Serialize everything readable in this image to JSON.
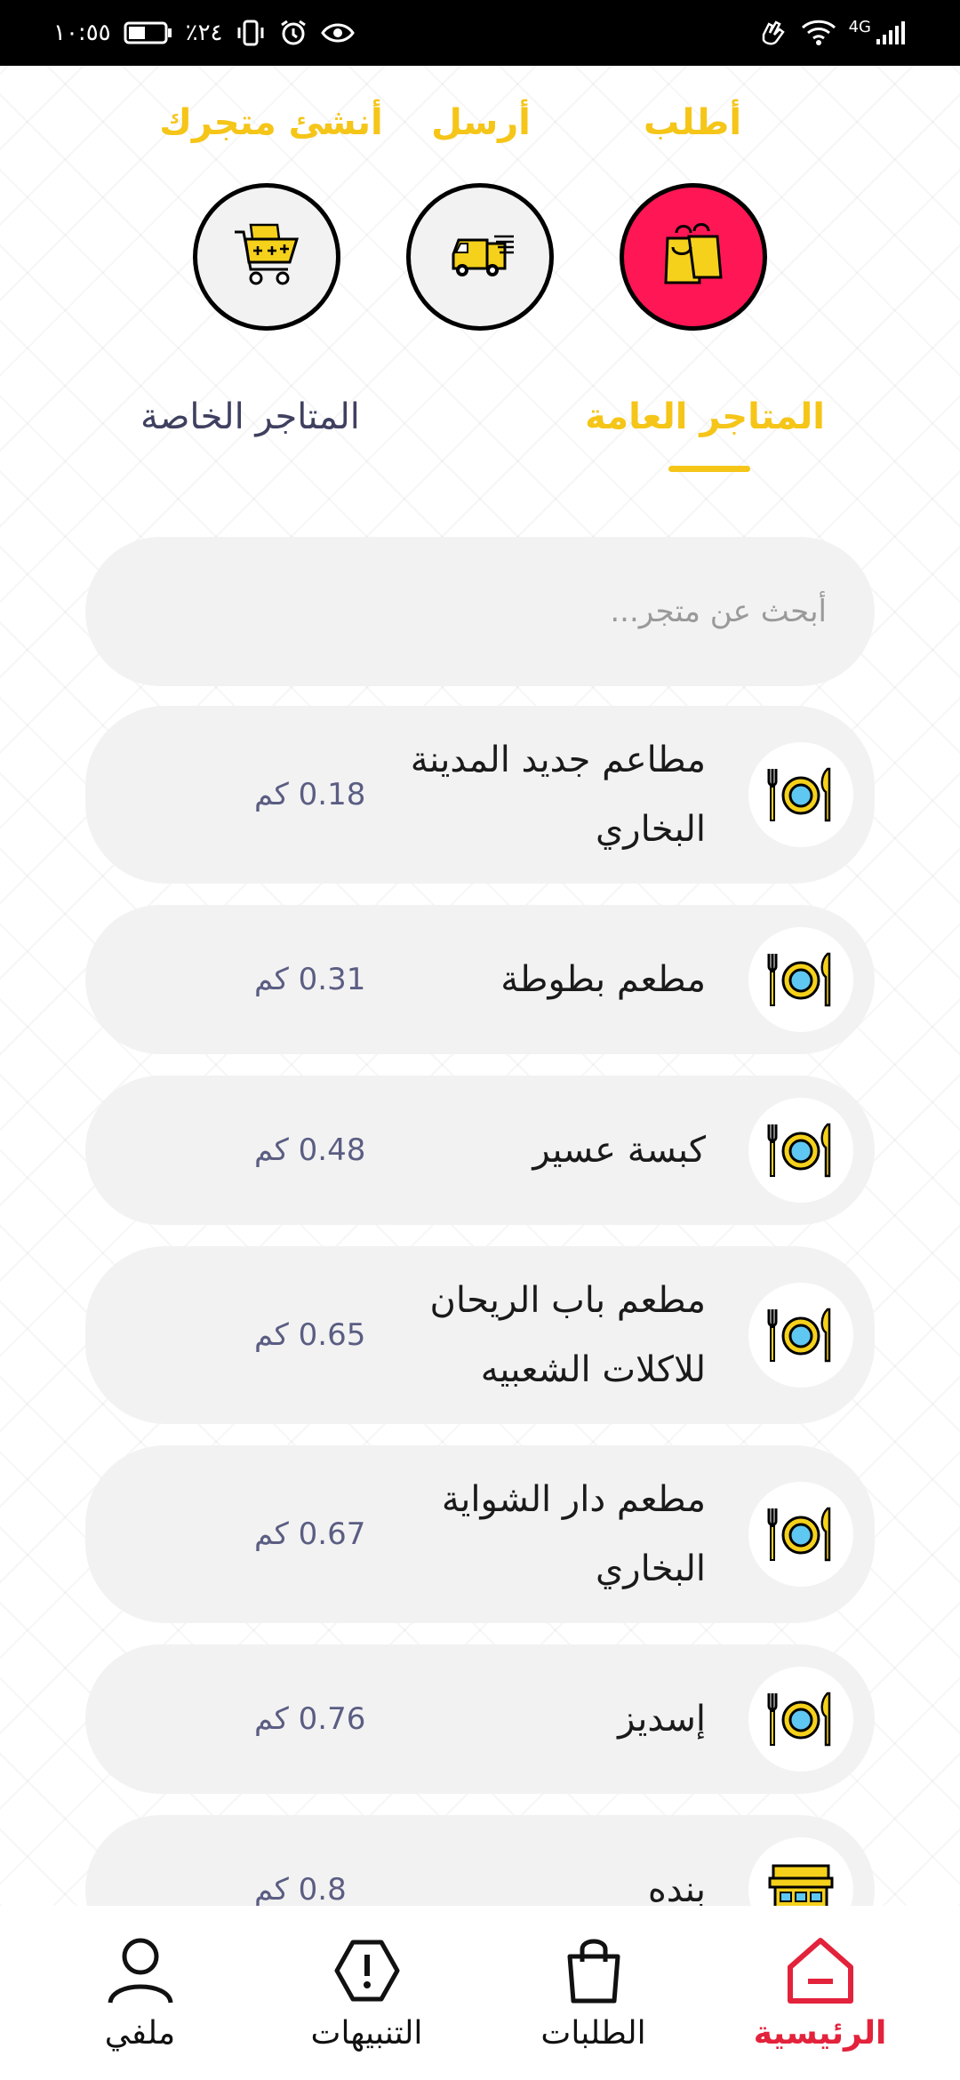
{
  "status_bar": {
    "time": "١٠:٥٥",
    "battery": "٪٢٤",
    "network": "4G"
  },
  "actions": [
    {
      "label": "أطلب",
      "icon": "shopping-bags-icon",
      "active": true
    },
    {
      "label": "أرسل",
      "icon": "delivery-truck-icon",
      "active": false
    },
    {
      "label": "أنشئ متجرك",
      "icon": "shopping-cart-icon",
      "active": false
    }
  ],
  "tabs": {
    "public": "المتاجر العامة",
    "private": "المتاجر الخاصة"
  },
  "search": {
    "placeholder": "أبحث عن متجر..."
  },
  "stores": [
    {
      "name": "مطاعم جديد المدينة البخاري",
      "distance": "0.18 كم",
      "icon": "plate-cutlery-icon"
    },
    {
      "name": "مطعم بطوطة",
      "distance": "0.31 كم",
      "icon": "plate-cutlery-icon"
    },
    {
      "name": "كبسة عسير",
      "distance": "0.48 كم",
      "icon": "plate-cutlery-icon"
    },
    {
      "name": "مطعم باب الريحان للاكلات الشعبيه",
      "distance": "0.65 كم",
      "icon": "plate-cutlery-icon"
    },
    {
      "name": "مطعم دار الشواية البخاري",
      "distance": "0.67 كم",
      "icon": "plate-cutlery-icon"
    },
    {
      "name": "إسديز",
      "distance": "0.76 كم",
      "icon": "plate-cutlery-icon"
    },
    {
      "name": "بنده",
      "distance": "0.8 كم",
      "icon": "storefront-icon"
    }
  ],
  "bottom_nav": [
    {
      "label": "الرئيسية",
      "icon": "home-icon",
      "active": true
    },
    {
      "label": "الطلبات",
      "icon": "shopping-bag-icon",
      "active": false
    },
    {
      "label": "التنبيهات",
      "icon": "alert-icon",
      "active": false
    },
    {
      "label": "ملفي",
      "icon": "user-icon",
      "active": false
    }
  ],
  "colors": {
    "accent": "#f5c518",
    "active_action": "#ff1654",
    "nav_active": "#e3223b"
  }
}
